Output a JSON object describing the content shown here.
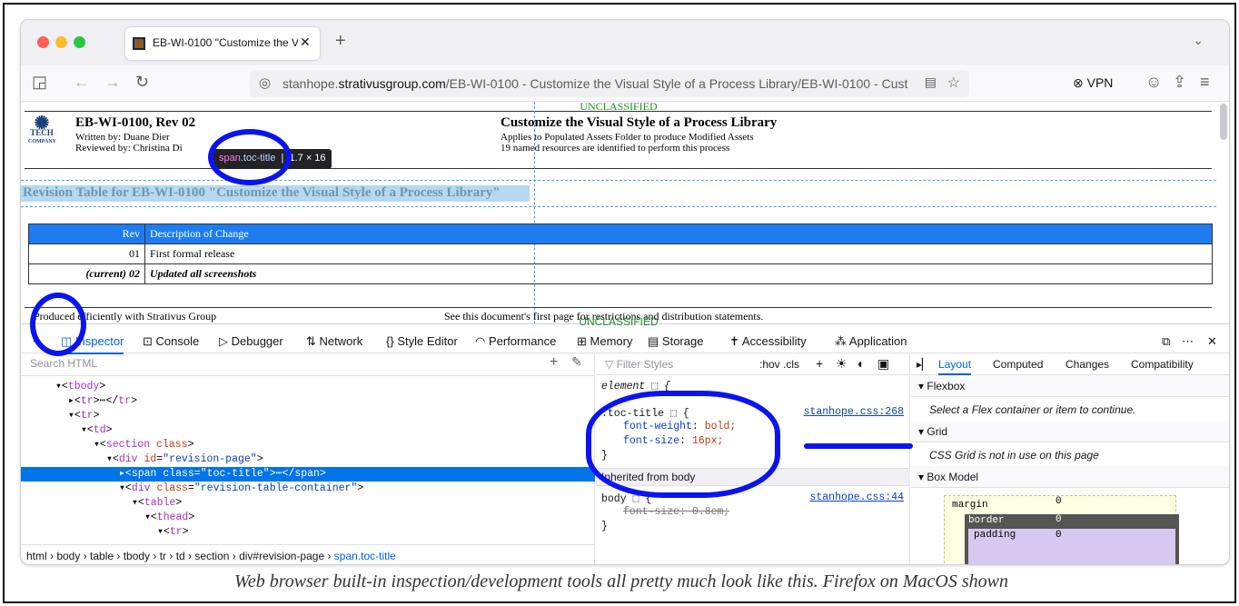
{
  "browser": {
    "tab_title": "EB-WI-0100 \"Customize the Vis",
    "url_domain": "stanhope.",
    "url_host": "strativusgroup.com",
    "url_path": "/EB-WI-0100 - Customize the Visual Style of a Process Library/EB-WI-0100 - Cust",
    "vpn_label": "VPN",
    "accent": "#0060df"
  },
  "page": {
    "classification_top": "UNCLASSIFIED",
    "classification_bottom": "UNCLASSIFIED",
    "logo_text": "TECH",
    "logo_sub": "COMPANY",
    "doc_id": "EB-WI-0100, Rev 02",
    "written_by": "Written by: Duane Dier",
    "reviewed_by": "Reviewed by: Christina Di",
    "doc_title": "Customize the Visual Style of a Process Library",
    "applies": "Applies to Populated Assets Folder to produce Modified Assets",
    "named": "19 named resources are identified to perform this process",
    "revision_title": "Revision Table for EB-WI-0100 \"Customize the Visual Style of a Process Library\"",
    "table": {
      "headers": [
        "Rev",
        "Description of Change"
      ],
      "rows": [
        [
          "01",
          "First formal release"
        ],
        [
          "(current) 02",
          "Updated all screenshots"
        ]
      ]
    },
    "footer_left": "Produced efficiently with Strativus Group",
    "footer_mid": "See this document's first page for restrictions and distribution statements.",
    "tooltip": {
      "tag": "span",
      "cls": ".toc-title",
      "size": "1.7 × 16"
    }
  },
  "devtools": {
    "tabs": [
      "Inspector",
      "Console",
      "Debugger",
      "Network",
      "Style Editor",
      "Performance",
      "Memory",
      "Storage",
      "Accessibility",
      "Application"
    ],
    "search_placeholder": "Search HTML",
    "breadcrumbs": "html › body › table › tbody › tr › td › section › div#revision-page › ",
    "breadcrumb_last": "span.toc-title",
    "filter_placeholder": "Filter Styles",
    "pseudo": ":hov .cls",
    "rule_element": "element ⬚ {",
    "rule_selector": ".toc-title ⬚ {",
    "rule_source": "stanhope.css:268",
    "prop1": "font-weight",
    "val1": "bold;",
    "prop2": "font-size",
    "val2": "16px;",
    "inherited": "Inherited from body",
    "body_rule": "body ⬚ {",
    "body_source": "stanhope.css:44",
    "body_prop": "font-size: 0.8em;",
    "layout_tabs": [
      "Layout",
      "Computed",
      "Changes",
      "Compatibility"
    ],
    "flexbox": "Flexbox",
    "flex_msg": "Select a Flex container or item to continue.",
    "grid": "Grid",
    "grid_msg": "CSS Grid is not in use on this page",
    "box_model": "Box Model",
    "bm_margin": "margin",
    "bm_border": "border",
    "bm_padding": "padding",
    "bm_zero": "0"
  },
  "caption": "Web browser built-in inspection/development tools all pretty much look like this. Firefox on MacOS shown"
}
